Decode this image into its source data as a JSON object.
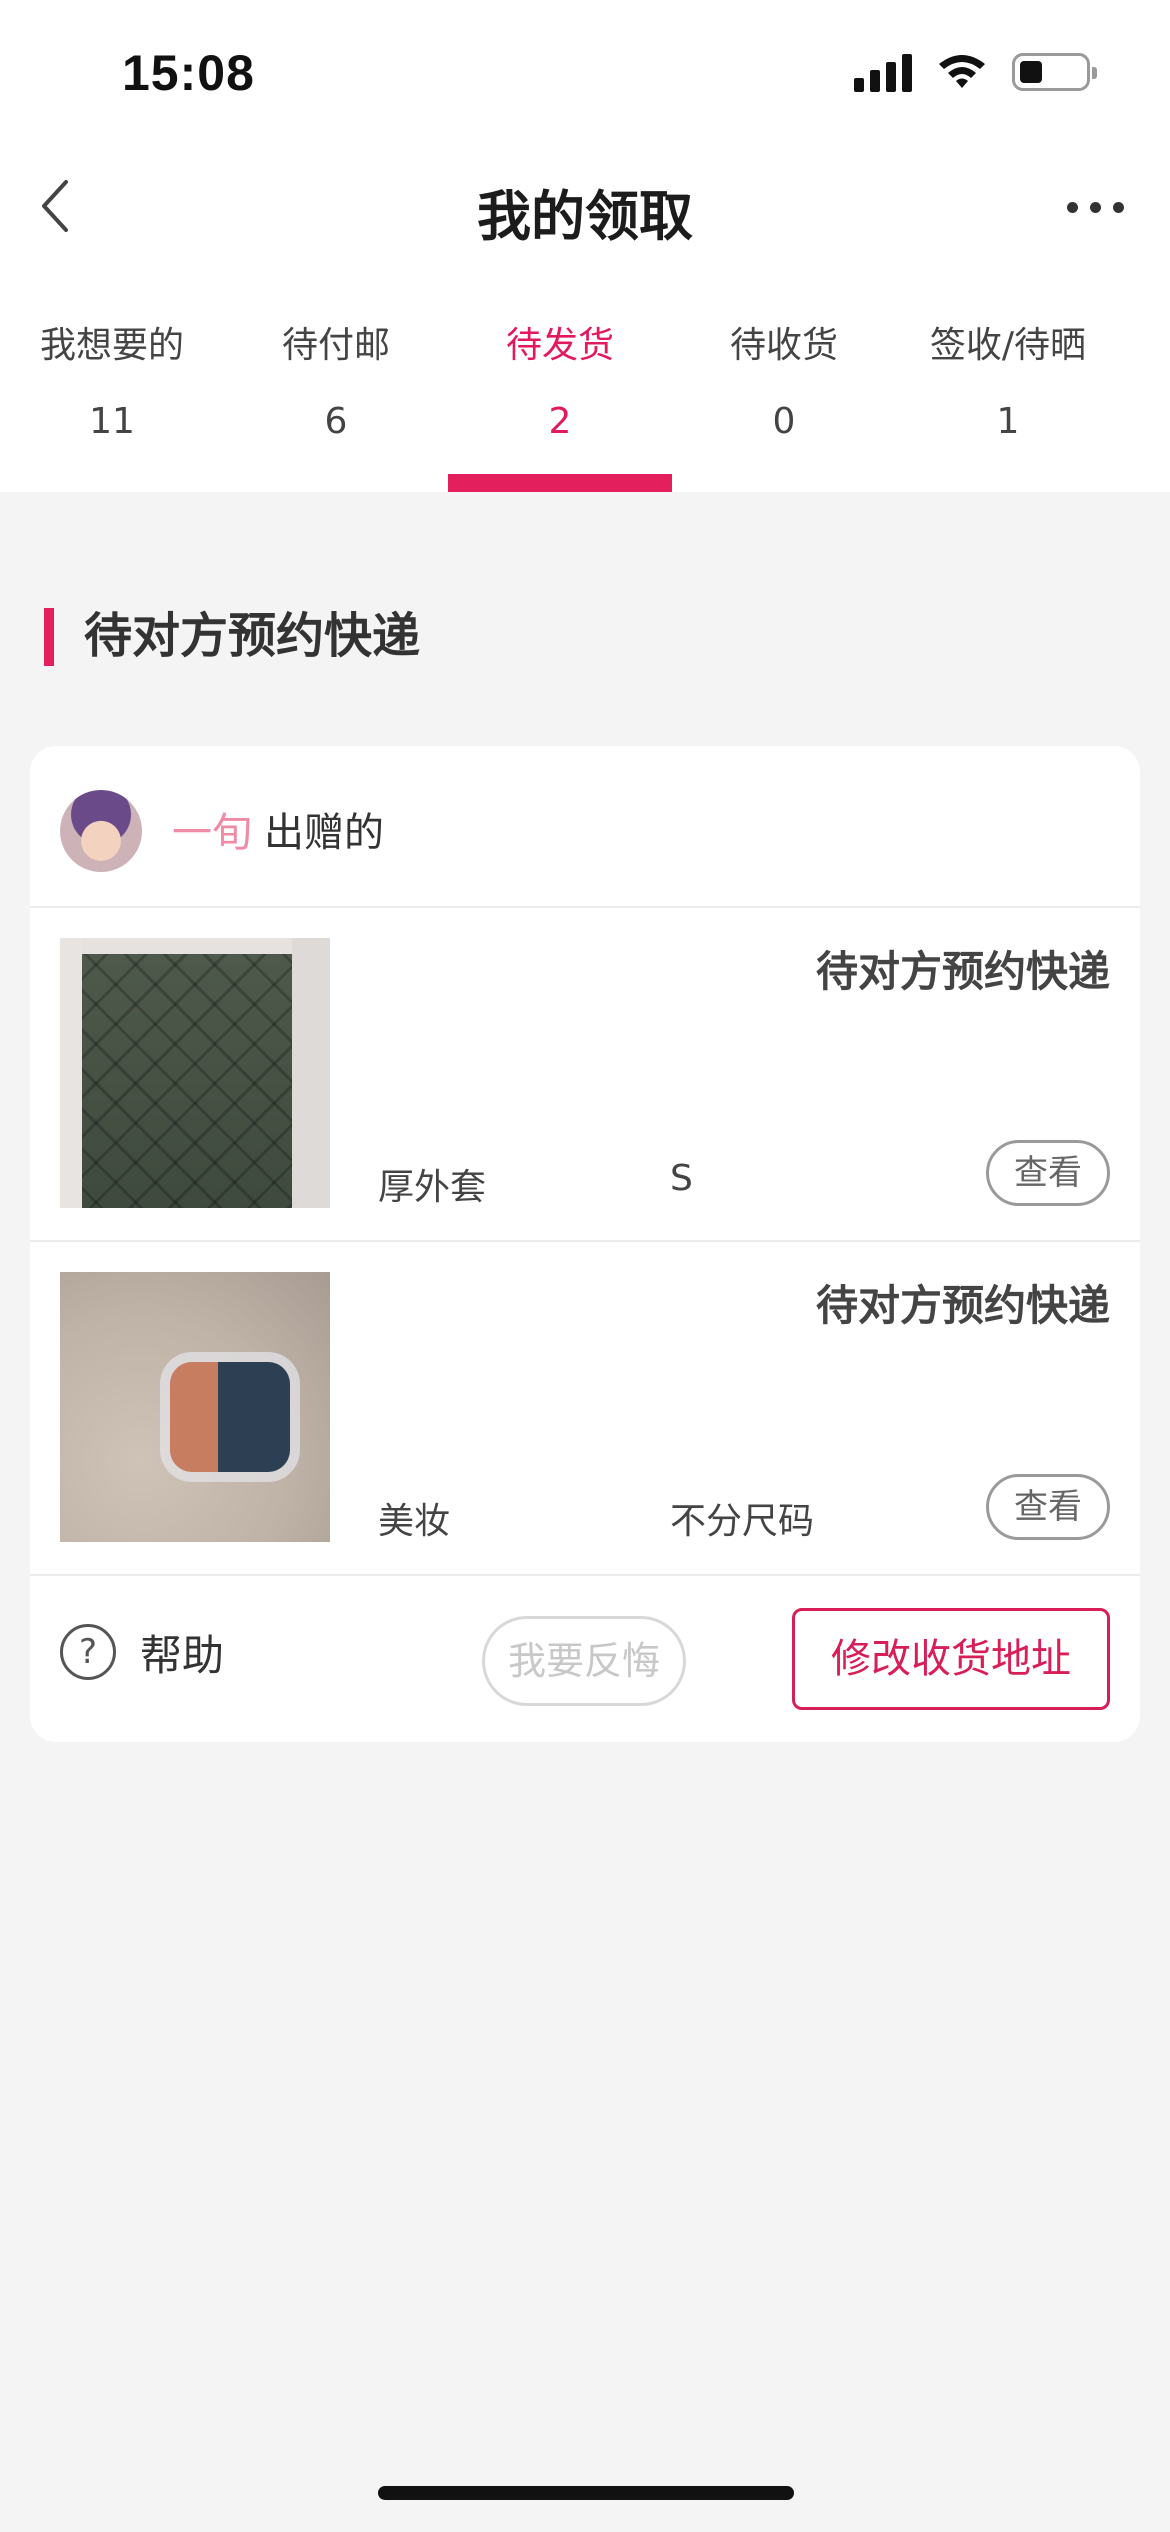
{
  "status_bar": {
    "time": "15:08",
    "battery_level": 0.3
  },
  "nav": {
    "title": "我的领取",
    "back_icon": "chevron-left-icon",
    "more_icon": "ellipsis-icon"
  },
  "tabs": [
    {
      "label": "我想要的",
      "count": "11",
      "active": false
    },
    {
      "label": "待付邮",
      "count": "6",
      "active": false
    },
    {
      "label": "待发货",
      "count": "2",
      "active": true
    },
    {
      "label": "待收货",
      "count": "0",
      "active": false
    },
    {
      "label": "签收/待晒",
      "count": "1",
      "active": false
    }
  ],
  "section": {
    "title": "待对方预约快递"
  },
  "card": {
    "giver": {
      "name": "一旬",
      "action": "出赠的"
    },
    "items": [
      {
        "status": "待对方预约快递",
        "name": "厚外套",
        "size": "S",
        "view_label": "查看",
        "image": "jacket"
      },
      {
        "status": "待对方预约快递",
        "name": "美妆",
        "size": "不分尺码",
        "view_label": "查看",
        "image": "cosmetic-jar"
      }
    ],
    "actions": {
      "help_label": "帮助",
      "regret_label": "我要反悔",
      "address_label": "修改收货地址"
    }
  },
  "colors": {
    "accent": "#e41f5e",
    "giver_name": "#f08aa5",
    "background": "#f4f4f4"
  }
}
